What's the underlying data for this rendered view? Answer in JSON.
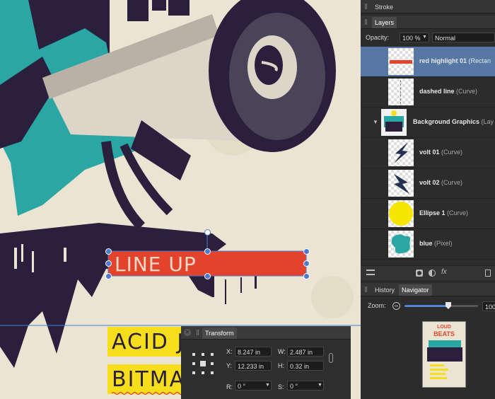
{
  "canvas": {
    "line_up_text": "LINE UP",
    "acid_text": "ACID J",
    "bitma_text": "BITMA"
  },
  "panels": {
    "stroke_tab": "Stroke",
    "layers_tab": "Layers",
    "opacity_label": "Opacity:",
    "opacity_value": "100 %",
    "blend_mode": "Normal",
    "layers": [
      {
        "name": "red highlight 01",
        "type": "(Rectan"
      },
      {
        "name": "dashed line",
        "type": "(Curve)"
      },
      {
        "name": "Background Graphics",
        "type": "(Lay"
      },
      {
        "name": "volt 01",
        "type": "(Curve)"
      },
      {
        "name": "volt 02",
        "type": "(Curve)"
      },
      {
        "name": "Ellipse 1",
        "type": "(Curve)"
      },
      {
        "name": "blue",
        "type": "(Pixel)"
      }
    ],
    "history_tab": "History",
    "navigator_tab": "Navigator",
    "zoom_label": "Zoom:",
    "zoom_value": "100",
    "nav_thumb_title_1": "LOUD",
    "nav_thumb_title_2": "BEATS"
  },
  "transform": {
    "title": "Transform",
    "x_label": "X:",
    "x_value": "8.247 in",
    "y_label": "Y:",
    "y_value": "12.233 in",
    "w_label": "W:",
    "w_value": "2.487 in",
    "h_label": "H:",
    "h_value": "0.32 in",
    "r_label": "R:",
    "r_value": "0 °",
    "s_label": "S:",
    "s_value": "0 °"
  },
  "colors": {
    "selection": "#5778a5",
    "red_highlight": "#e2432a",
    "teal": "#2aa6a4",
    "ink": "#2a1f3d",
    "yellow": "#f6de1d"
  }
}
